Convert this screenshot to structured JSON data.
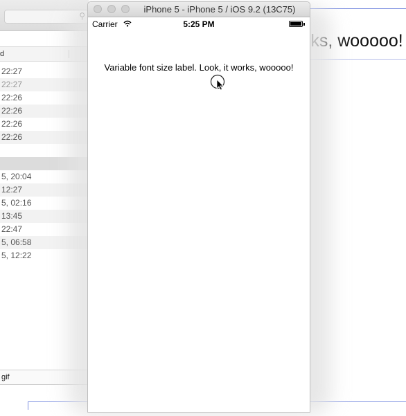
{
  "finder": {
    "column_header": "d",
    "rows": [
      {
        "text": "22:27",
        "dim": false
      },
      {
        "text": "22:27",
        "dim": true
      },
      {
        "text": "22:26",
        "dim": false
      },
      {
        "text": "22:26",
        "dim": false
      },
      {
        "text": "22:26",
        "dim": false
      },
      {
        "text": "22:26",
        "dim": false
      },
      {
        "text": "",
        "dim": false
      },
      {
        "text": "",
        "dim": false,
        "selected": true
      },
      {
        "text": "5, 20:04",
        "dim": false
      },
      {
        "text": "12:27",
        "dim": false
      },
      {
        "text": "5, 02:16",
        "dim": false
      },
      {
        "text": "13:45",
        "dim": false
      },
      {
        "text": "22:47",
        "dim": false
      },
      {
        "text": "5, 06:58",
        "dim": false
      },
      {
        "text": "5, 12:22",
        "dim": false
      }
    ],
    "file_label": "gif"
  },
  "background_window": {
    "large_text": "rks, wooooo!"
  },
  "simulator": {
    "title": "iPhone 5 - iPhone 5 / iOS 9.2 (13C75)",
    "status": {
      "carrier": "Carrier",
      "time": "5:25 PM"
    },
    "label_text": "Variable font size label. Look, it works, wooooo!"
  }
}
